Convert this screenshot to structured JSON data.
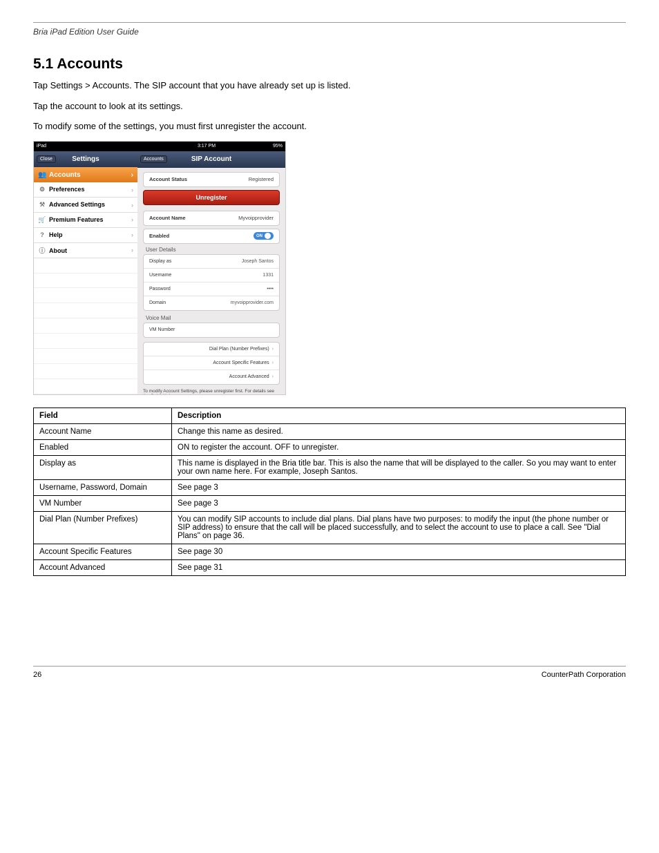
{
  "running_header": "Bria iPad Edition User Guide",
  "section_heading": "5.1 Accounts",
  "intro_1": "Tap Settings > Accounts. The SIP account that you have already set up is listed.",
  "intro_2": "Tap the account to look at its settings.",
  "intro_3": "To modify some of the settings, you must first unregister the account.",
  "screenshot": {
    "status_left": "iPad",
    "status_center": "3:17 PM",
    "status_right": "95%",
    "left": {
      "close": "Close",
      "title": "Settings",
      "selected": "Accounts",
      "items": [
        "Preferences",
        "Advanced Settings",
        "Premium Features",
        "Help",
        "About"
      ]
    },
    "right": {
      "back": "Accounts",
      "title": "SIP Account",
      "account_status_label": "Account Status",
      "account_status_value": "Registered",
      "unregister": "Unregister",
      "account_name_label": "Account Name",
      "account_name_value": "Myvoipprovider",
      "enabled_label": "Enabled",
      "enabled_toggle": "ON",
      "user_details": "User Details",
      "display_as_label": "Display as",
      "display_as_value": "Joseph Santos",
      "username_label": "Username",
      "username_value": "1331",
      "password_label": "Password",
      "password_value": "••••",
      "domain_label": "Domain",
      "domain_value": "myvoipprovider.com",
      "voice_mail": "Voice Mail",
      "vm_number": "VM Number",
      "links": [
        "Dial Plan (Number Prefixes)",
        "Account Specific Features",
        "Account Advanced"
      ],
      "footnote": "To modify Account Settings, please unregister first. For details see the Quick Help."
    }
  },
  "table": {
    "head_field": "Field",
    "head_desc": "Description",
    "rows": [
      {
        "f": "Account Name",
        "d": "Change this name as desired."
      },
      {
        "f": "Enabled",
        "d": "ON to register the account. OFF to unregister."
      },
      {
        "f": "Display as",
        "d": "This name is displayed in the Bria title bar. This is also the name that will be displayed to the caller. So you may want to enter your own name here. For example, Joseph Santos."
      },
      {
        "f": "Username, Password, Domain",
        "d": "See page 3"
      },
      {
        "f": "VM Number",
        "d": "See page 3"
      },
      {
        "f": "Dial Plan (Number Prefixes)",
        "d": "You can modify SIP accounts to include dial plans. Dial plans have two purposes: to modify the input (the phone number or SIP address) to ensure that the call will be placed successfully, and to select the account to use to place a call. See \"Dial Plans\" on page 36."
      },
      {
        "f": "Account Specific Features",
        "d": "See page 30"
      },
      {
        "f": "Account Advanced",
        "d": "See page 31"
      }
    ]
  },
  "footer_left": "26",
  "footer_right": "CounterPath Corporation"
}
